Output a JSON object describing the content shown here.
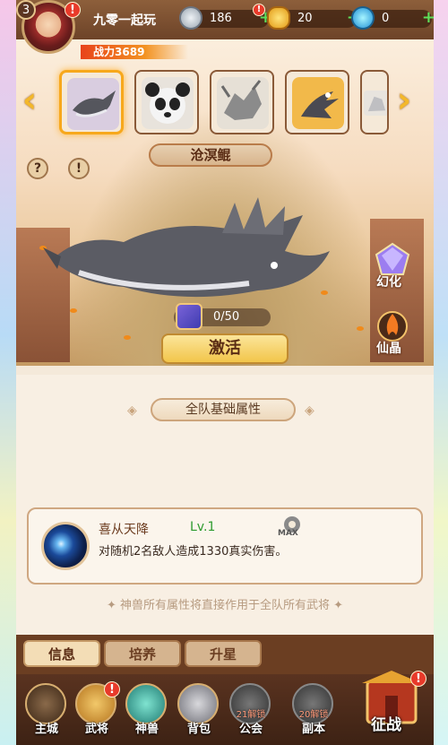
{
  "player": {
    "name": "九零一起玩",
    "level": "3",
    "power_label": "战力",
    "power": "3689"
  },
  "resources": [
    {
      "icon": "silver-coin-icon",
      "amount": "186"
    },
    {
      "icon": "gold-ingot-icon",
      "amount": "20"
    },
    {
      "icon": "jade-gem-icon",
      "amount": "0"
    }
  ],
  "pets": [
    {
      "name": "沧溟鲲",
      "icon": "whale-beast-icon",
      "selected": true
    },
    {
      "name": "",
      "icon": "panda-icon",
      "selected": false
    },
    {
      "name": "",
      "icon": "dragon-icon",
      "selected": false
    },
    {
      "name": "",
      "icon": "phoenix-icon",
      "selected": false
    },
    {
      "name": "",
      "icon": "unknown-beast-icon",
      "selected": false
    }
  ],
  "selected_pet_name": "沧溟鲲",
  "scene": {
    "transform_label": "幻化",
    "crystal_label": "仙晶",
    "fragment_progress": "0/50",
    "activate_label": "激活"
  },
  "attributes": {
    "banner": "全队基础属性"
  },
  "skill": {
    "name": "喜从天降",
    "level": "Lv.1",
    "description": "对随机2名敌人造成1330真实伤害。",
    "max_badge": "MAX"
  },
  "footnote": "神兽所有属性将直接作用于全队所有武将",
  "tabs": [
    {
      "label": "信息",
      "active": true
    },
    {
      "label": "培养",
      "active": false
    },
    {
      "label": "升星",
      "active": false
    }
  ],
  "nav": [
    {
      "label": "主城",
      "locked": false
    },
    {
      "label": "武将",
      "locked": false,
      "alert": true
    },
    {
      "label": "神兽",
      "locked": false
    },
    {
      "label": "背包",
      "locked": false
    },
    {
      "label": "公会",
      "locked": true,
      "lock_text": "21解锁"
    },
    {
      "label": "副本",
      "locked": true,
      "lock_text": "20解锁"
    }
  ],
  "expedition_label": "征战",
  "colors": {
    "accent": "#f3b82a",
    "brown": "#6b3e22",
    "alert": "#e83a2a",
    "level_green": "#2e9a2e"
  }
}
